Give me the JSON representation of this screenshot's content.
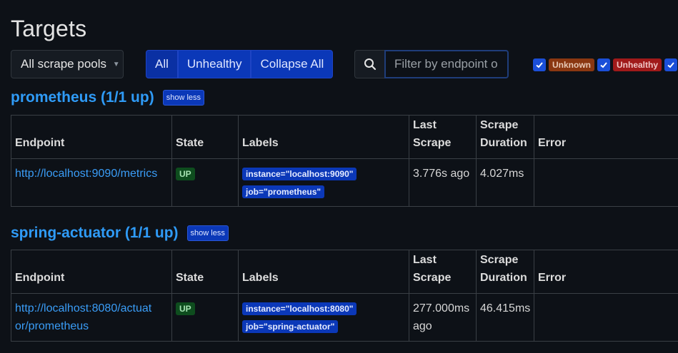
{
  "page": {
    "title": "Targets"
  },
  "toolbar": {
    "pools_select": "All scrape pools",
    "buttons": {
      "all": "All",
      "unhealthy": "Unhealthy",
      "collapse_all": "Collapse All"
    },
    "search_placeholder": "Filter by endpoint o",
    "filters": {
      "unknown": "Unknown",
      "unhealthy": "Unhealthy"
    }
  },
  "colors": {
    "background": "#0d1117",
    "accent": "#0b38b8",
    "link": "#2f9bf7",
    "state_up": "#0e4d1e",
    "unknown": "#8a3711",
    "unhealthy": "#a01a1a"
  },
  "icons": {
    "search": "search-icon",
    "check": "check-icon",
    "caret": "chevron-down-icon"
  },
  "table_headers": {
    "endpoint": "Endpoint",
    "state": "State",
    "labels": "Labels",
    "last_scrape_1": "Last",
    "last_scrape_2": "Scrape",
    "scrape_duration_1": "Scrape",
    "scrape_duration_2": "Duration",
    "error": "Error"
  },
  "pools": [
    {
      "title": "prometheus (1/1 up)",
      "toggle": "show less",
      "rows": [
        {
          "endpoint": "http://localhost:9090/metrics",
          "state": "UP",
          "labels": [
            "instance=\"localhost:9090\"",
            "job=\"prometheus\""
          ],
          "last_scrape": "3.776s ago",
          "duration": "4.027ms",
          "error": ""
        }
      ]
    },
    {
      "title": "spring-actuator (1/1 up)",
      "toggle": "show less",
      "rows": [
        {
          "endpoint_1": "http://localhost:8080/actuat",
          "endpoint_2": "or/prometheus",
          "state": "UP",
          "labels": [
            "instance=\"localhost:8080\"",
            "job=\"spring-actuator\""
          ],
          "last_scrape_1": "277.000ms",
          "last_scrape_2": "ago",
          "duration": "46.415ms",
          "error": ""
        }
      ]
    }
  ]
}
